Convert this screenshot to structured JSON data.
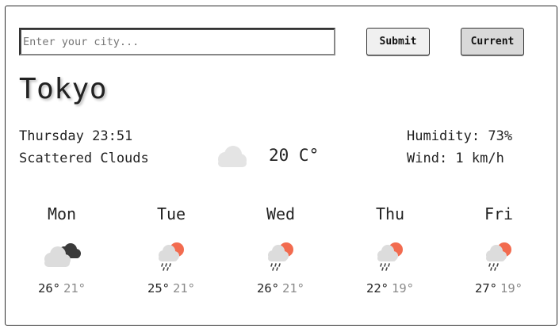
{
  "search": {
    "placeholder": "Enter your city..."
  },
  "buttons": {
    "submit": "Submit",
    "current": "Current"
  },
  "current": {
    "city": "Tokyo",
    "datetime": "Thursday 23:51",
    "description": "Scattered Clouds",
    "temperature": "20 C°",
    "humidity": "Humidity: 73%",
    "wind": "Wind: 1 km/h",
    "icon": "cloud-icon"
  },
  "forecast": [
    {
      "day": "Mon",
      "high": "26°",
      "low": "21°",
      "icon": "broken-clouds-icon"
    },
    {
      "day": "Tue",
      "high": "25°",
      "low": "21°",
      "icon": "sun-rain-cloud-icon"
    },
    {
      "day": "Wed",
      "high": "26°",
      "low": "21°",
      "icon": "sun-rain-cloud-icon"
    },
    {
      "day": "Thu",
      "high": "22°",
      "low": "19°",
      "icon": "sun-rain-cloud-icon"
    },
    {
      "day": "Fri",
      "high": "27°",
      "low": "19°",
      "icon": "sun-rain-cloud-icon"
    }
  ],
  "colors": {
    "sun": "#f26b4f",
    "cloud_light": "#e4e4e4",
    "cloud_dark": "#3a3a3a",
    "low_temp": "#8a8a8a"
  }
}
